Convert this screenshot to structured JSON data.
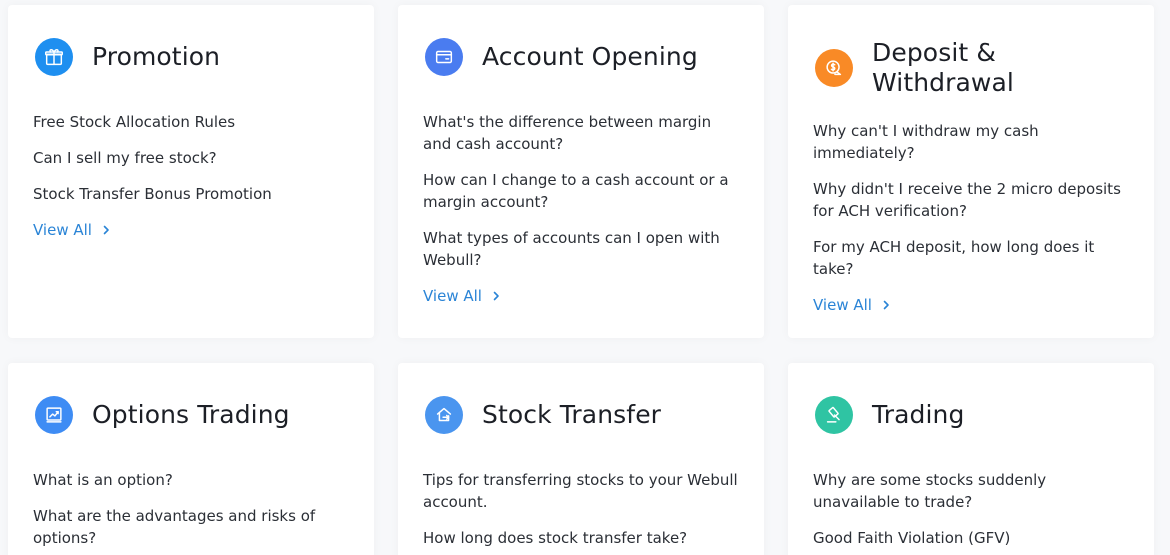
{
  "colors": {
    "promotion_icon": "#1e8ff0",
    "account_icon": "#4a7cf0",
    "deposit_icon": "#f98a26",
    "options_icon": "#3e8cf4",
    "transfer_icon": "#4a95ef",
    "trading_icon": "#2fc4a3",
    "link": "#2a84d6"
  },
  "cards": [
    {
      "title": "Promotion",
      "icon": "gift-icon",
      "questions": [
        "Free Stock Allocation Rules",
        "Can I sell my free stock?",
        "Stock Transfer Bonus Promotion"
      ],
      "view_all": "View All"
    },
    {
      "title": "Account Opening",
      "icon": "wallet-icon",
      "questions": [
        "What's the difference between margin and cash account?",
        "How can I change to a cash account or a margin account?",
        "What types of accounts can I open with Webull?"
      ],
      "view_all": "View All"
    },
    {
      "title": "Deposit & Withdrawal",
      "icon": "dollar-coin-icon",
      "questions": [
        "Why can't I withdraw my cash immediately?",
        "Why didn't I receive the 2 micro deposits for ACH verification?",
        "For my ACH deposit, how long does it take?"
      ],
      "view_all": "View All"
    },
    {
      "title": "Options Trading",
      "icon": "chart-board-icon",
      "questions": [
        "What is an option?",
        "What are the advantages and risks of options?"
      ]
    },
    {
      "title": "Stock Transfer",
      "icon": "transfer-house-icon",
      "questions": [
        "Tips for transferring stocks to your Webull account.",
        "How long does stock transfer take?"
      ]
    },
    {
      "title": "Trading",
      "icon": "gavel-icon",
      "questions": [
        "Why are some stocks suddenly unavailable to trade?",
        "Good Faith Violation (GFV)"
      ]
    }
  ]
}
